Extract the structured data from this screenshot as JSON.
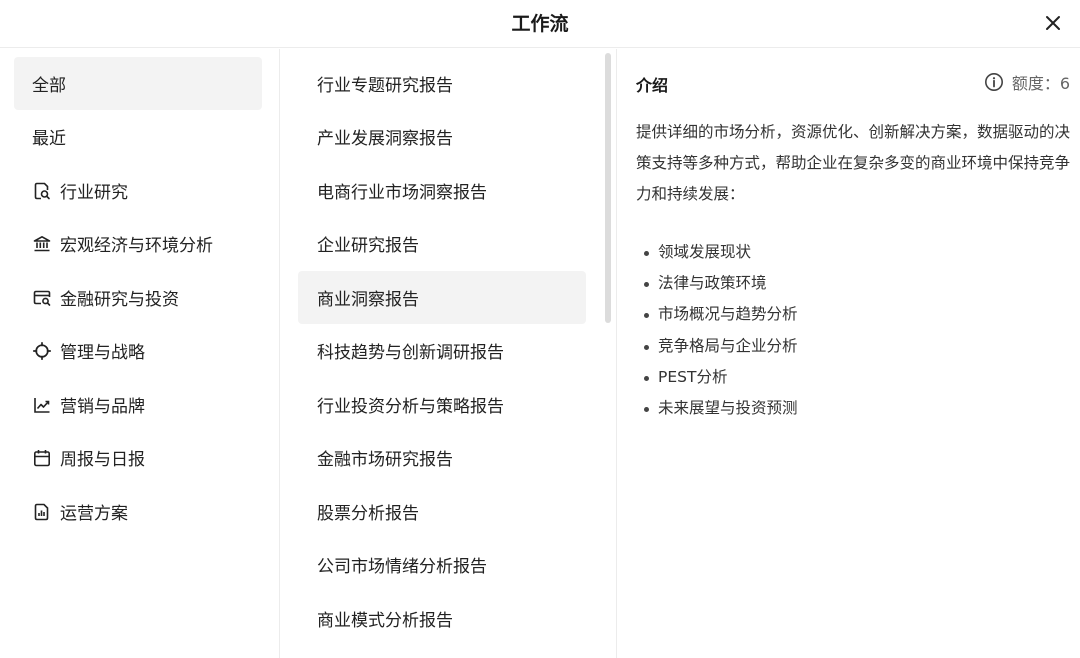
{
  "header": {
    "title": "工作流"
  },
  "categories": [
    {
      "label": "全部",
      "icon": null,
      "active": true
    },
    {
      "label": "最近",
      "icon": null,
      "active": false
    },
    {
      "label": "行业研究",
      "icon": "document-search-icon",
      "active": false
    },
    {
      "label": "宏观经济与环境分析",
      "icon": "bank-icon",
      "active": false
    },
    {
      "label": "金融研究与投资",
      "icon": "card-search-icon",
      "active": false
    },
    {
      "label": "管理与战略",
      "icon": "crosshair-icon",
      "active": false
    },
    {
      "label": "营销与品牌",
      "icon": "trend-chart-icon",
      "active": false
    },
    {
      "label": "周报与日报",
      "icon": "calendar-icon",
      "active": false
    },
    {
      "label": "运营方案",
      "icon": "report-chart-icon",
      "active": false
    }
  ],
  "workflows": [
    {
      "label": "行业专题研究报告",
      "active": false
    },
    {
      "label": "产业发展洞察报告",
      "active": false
    },
    {
      "label": "电商行业市场洞察报告",
      "active": false
    },
    {
      "label": "企业研究报告",
      "active": false
    },
    {
      "label": "商业洞察报告",
      "active": true
    },
    {
      "label": "科技趋势与创新调研报告",
      "active": false
    },
    {
      "label": "行业投资分析与策略报告",
      "active": false
    },
    {
      "label": "金融市场研究报告",
      "active": false
    },
    {
      "label": "股票分析报告",
      "active": false
    },
    {
      "label": "公司市场情绪分析报告",
      "active": false
    },
    {
      "label": "商业模式分析报告",
      "active": false
    }
  ],
  "detail": {
    "title": "介绍",
    "quota_label": "额度：6",
    "description": "提供详细的市场分析，资源优化、创新解决方案，数据驱动的决策支持等多种方式，帮助企业在复杂多变的商业环境中保持竞争力和持续发展：",
    "bullets": [
      "领域发展现状",
      "法律与政策环境",
      "市场概况与趋势分析",
      "竞争格局与企业分析",
      "PEST分析",
      "未来展望与投资预测"
    ]
  }
}
